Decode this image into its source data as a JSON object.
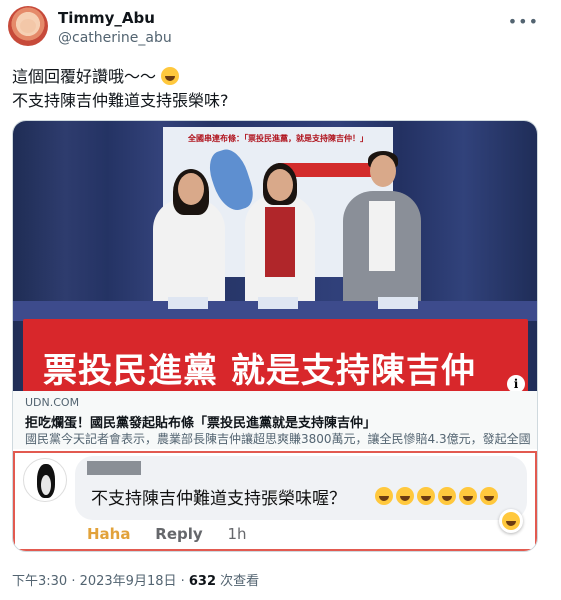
{
  "author": {
    "display_name": "Timmy_Abu",
    "handle": "@catherine_abu"
  },
  "tweet": {
    "line1": "這個回覆好讚哦～～",
    "line2": "不支持陳吉仲難道支持張榮味?"
  },
  "link_card": {
    "domain": "UDN.COM",
    "title": "拒吃爛蛋！國民黨發起貼布條「票投民進黨就是支持陳吉仲」",
    "description": "國民黨今天記者會表示，農業部長陳吉仲讓超思爽賺3800萬元，讓全民慘賠4.3億元，發起全國串…",
    "photo_banner_text": "票投民進黨 就是支持陳吉仲",
    "photo_top_text": "全國串連布條：「票投民進黨，就是支持陳吉仲！」"
  },
  "comment": {
    "text": "不支持陳吉仲難道支持張榮味喔？",
    "actions": {
      "haha": "Haha",
      "reply": "Reply",
      "time": "1h"
    }
  },
  "footer": {
    "timestamp": "下午3:30 · 2023年9月18日 · ",
    "views_count": "632",
    "views_label": " 次查看"
  },
  "colors": {
    "highlight_border": "#e25a50",
    "haha": "#e2a23a"
  }
}
